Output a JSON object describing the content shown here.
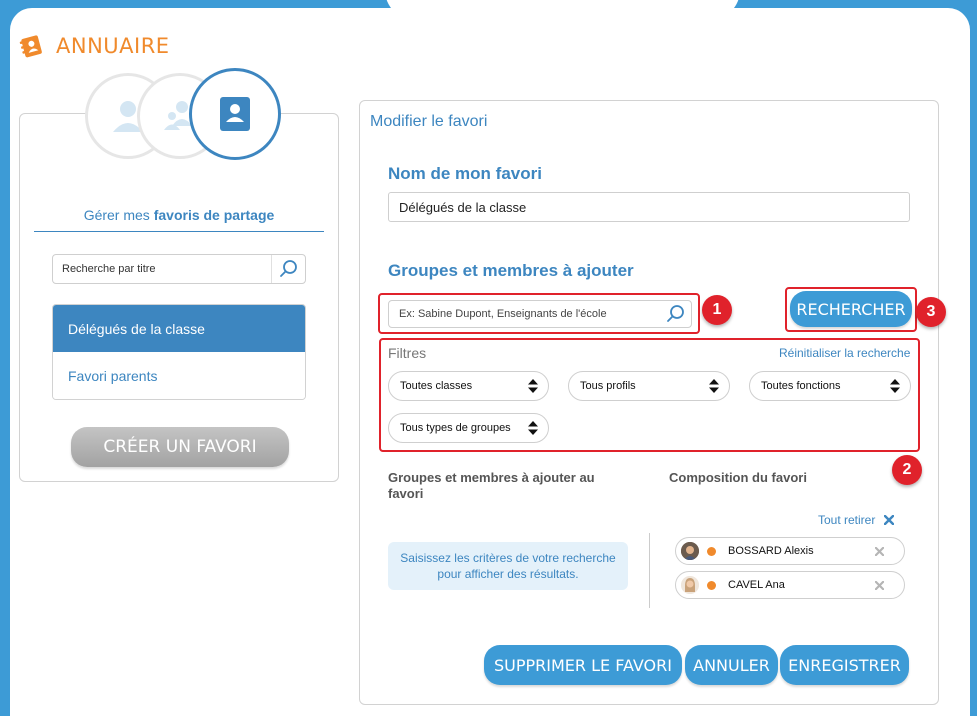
{
  "colors": {
    "frame_blue": "#3d9bd6",
    "accent_blue": "#3d86c0",
    "orange": "#f08a2c",
    "annotation_red": "#e0222b",
    "hint_bg": "#e4f1fa",
    "status_orange": "#f08a2c"
  },
  "app": {
    "title": "ANNUAIRE",
    "logo_icon": "directory-book-icon"
  },
  "left_panel": {
    "avatar_icons": [
      "user-icon",
      "users-icon",
      "contact-card-icon"
    ],
    "share_title_prefix": "Gérer mes",
    "share_title_bold": "favoris de partage",
    "search": {
      "placeholder": "Recherche par titre",
      "icon": "search-icon"
    },
    "favorites": [
      {
        "label": "Délégués de la classe",
        "selected": true
      },
      {
        "label": "Favori parents",
        "selected": false
      }
    ],
    "create_button": "CRÉER UN FAVORI"
  },
  "main": {
    "panel_title": "Modifier le favori",
    "name_label": "Nom de mon favori",
    "name_value": "Délégués de la classe",
    "add_section_label": "Groupes et membres à ajouter",
    "member_search_placeholder": "Ex: Sabine Dupont, Enseignants de l'école",
    "search_button": "RECHERCHER",
    "filters_label": "Filtres",
    "reset_link": "Réinitialiser la recherche",
    "filters": [
      "Toutes classes",
      "Tous profils",
      "Toutes fonctions",
      "Tous types de groupes"
    ],
    "badges": [
      "1",
      "2",
      "3"
    ],
    "left_column_title": "Groupes et membres à ajouter au favori",
    "right_column_title": "Composition du favori",
    "hint_text": "Saisissez les critères de votre recherche pour afficher des résultats.",
    "remove_all": "Tout retirer",
    "members": [
      {
        "name": "BOSSARD Alexis",
        "status_icon": "orange-status-dot",
        "avatar_icon": "child-photo-icon"
      },
      {
        "name": "CAVEL Ana",
        "status_icon": "orange-status-dot",
        "avatar_icon": "child-photo-icon"
      }
    ],
    "buttons": {
      "delete": "SUPPRIMER LE FAVORI",
      "cancel": "ANNULER",
      "save": "ENREGISTRER"
    }
  }
}
